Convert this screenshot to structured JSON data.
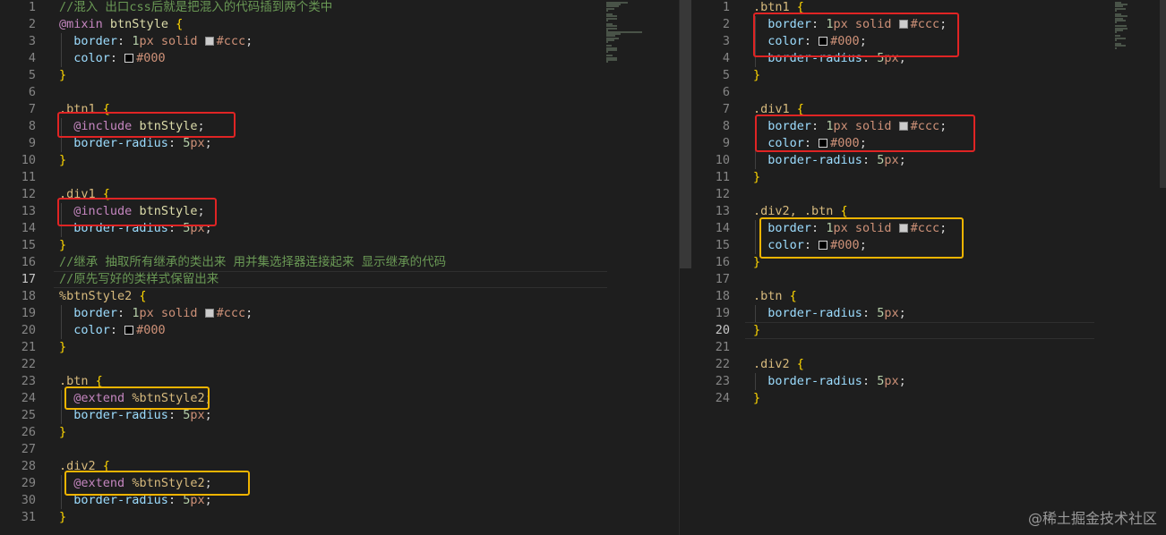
{
  "left_editor": {
    "lines": [
      {
        "n": "1",
        "text": "//混入 出口css后就是把混入的代码插到两个类中"
      },
      {
        "n": "2",
        "text": "@mixin btnStyle {"
      },
      {
        "n": "3",
        "text": "  border: 1px solid #ccc;"
      },
      {
        "n": "4",
        "text": "  color: #000"
      },
      {
        "n": "5",
        "text": "}"
      },
      {
        "n": "6",
        "text": ""
      },
      {
        "n": "7",
        "text": ".btn1 {"
      },
      {
        "n": "8",
        "text": "  @include btnStyle;"
      },
      {
        "n": "9",
        "text": "  border-radius: 5px;"
      },
      {
        "n": "10",
        "text": "}"
      },
      {
        "n": "11",
        "text": ""
      },
      {
        "n": "12",
        "text": ".div1 {"
      },
      {
        "n": "13",
        "text": "  @include btnStyle;"
      },
      {
        "n": "14",
        "text": "  border-radius: 5px;"
      },
      {
        "n": "15",
        "text": "}"
      },
      {
        "n": "16",
        "text": "//继承 抽取所有继承的类出来 用并集选择器连接起来 显示继承的代码"
      },
      {
        "n": "17",
        "text": "//原先写好的类样式保留出来"
      },
      {
        "n": "18",
        "text": "%btnStyle2 {"
      },
      {
        "n": "19",
        "text": "  border: 1px solid #ccc;"
      },
      {
        "n": "20",
        "text": "  color: #000"
      },
      {
        "n": "21",
        "text": "}"
      },
      {
        "n": "22",
        "text": ""
      },
      {
        "n": "23",
        "text": ".btn {"
      },
      {
        "n": "24",
        "text": "  @extend %btnStyle2;"
      },
      {
        "n": "25",
        "text": "  border-radius: 5px;"
      },
      {
        "n": "26",
        "text": "}"
      },
      {
        "n": "27",
        "text": ""
      },
      {
        "n": "28",
        "text": ".div2 {"
      },
      {
        "n": "29",
        "text": "  @extend %btnStyle2;"
      },
      {
        "n": "30",
        "text": "  border-radius: 5px;"
      },
      {
        "n": "31",
        "text": "}"
      }
    ],
    "active_line": "17"
  },
  "right_editor": {
    "lines": [
      {
        "n": "1",
        "text": ".btn1 {"
      },
      {
        "n": "2",
        "text": "  border: 1px solid #ccc;"
      },
      {
        "n": "3",
        "text": "  color: #000;"
      },
      {
        "n": "4",
        "text": "  border-radius: 5px;"
      },
      {
        "n": "5",
        "text": "}"
      },
      {
        "n": "6",
        "text": ""
      },
      {
        "n": "7",
        "text": ".div1 {"
      },
      {
        "n": "8",
        "text": "  border: 1px solid #ccc;"
      },
      {
        "n": "9",
        "text": "  color: #000;"
      },
      {
        "n": "10",
        "text": "  border-radius: 5px;"
      },
      {
        "n": "11",
        "text": "}"
      },
      {
        "n": "12",
        "text": ""
      },
      {
        "n": "13",
        "text": ".div2, .btn {"
      },
      {
        "n": "14",
        "text": "  border: 1px solid #ccc;"
      },
      {
        "n": "15",
        "text": "  color: #000;"
      },
      {
        "n": "16",
        "text": "}"
      },
      {
        "n": "17",
        "text": ""
      },
      {
        "n": "18",
        "text": ".btn {"
      },
      {
        "n": "19",
        "text": "  border-radius: 5px;"
      },
      {
        "n": "20",
        "text": "}"
      },
      {
        "n": "21",
        "text": ""
      },
      {
        "n": "22",
        "text": ".div2 {"
      },
      {
        "n": "23",
        "text": "  border-radius: 5px;"
      },
      {
        "n": "24",
        "text": "}"
      }
    ],
    "active_line": "20"
  },
  "colors": {
    "highlight_red": "#e02424",
    "highlight_yellow": "#f0b400",
    "editor_bg": "#1e1e1e"
  },
  "watermark": "@稀土掘金技术社区"
}
